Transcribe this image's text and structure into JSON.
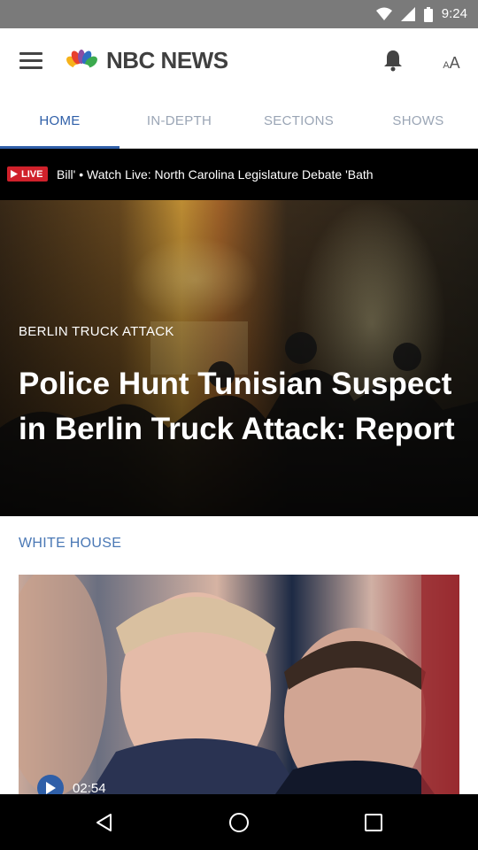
{
  "status_bar": {
    "time": "9:24"
  },
  "app_bar": {
    "logo_text": "NBC NEWS",
    "font_size_small": "A",
    "font_size_big": "A"
  },
  "tabs": [
    {
      "label": "HOME",
      "active": true
    },
    {
      "label": "IN-DEPTH",
      "active": false
    },
    {
      "label": "SECTIONS",
      "active": false
    },
    {
      "label": "SHOWS",
      "active": false
    }
  ],
  "ticker": {
    "badge": "LIVE",
    "text": "Bill'  •  Watch Live: North Carolina Legislature Debate 'Bath"
  },
  "hero": {
    "kicker": "BERLIN TRUCK ATTACK",
    "title": "Police Hunt Tunisian Suspect in Berlin Truck Attack: Report"
  },
  "section": {
    "label": "WHITE HOUSE",
    "video_duration": "02:54"
  },
  "colors": {
    "accent": "#2f5fa8",
    "live_red": "#d0212b",
    "section_blue": "#4a78b5"
  },
  "icons": {
    "menu": "hamburger-menu-icon",
    "bell": "bell-icon",
    "play": "play-icon",
    "back": "back-icon",
    "home": "home-icon",
    "recents": "recents-icon"
  }
}
